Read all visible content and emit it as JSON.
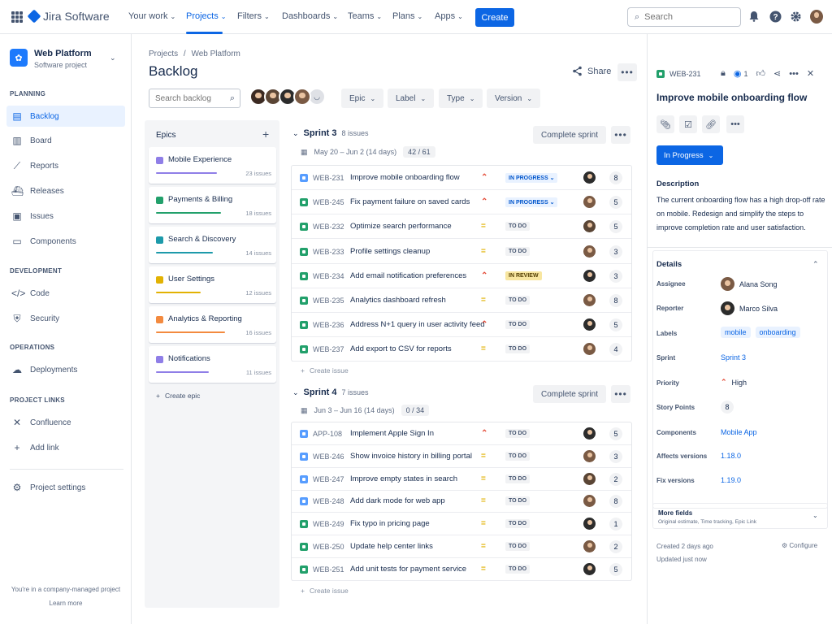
{
  "nav": {
    "product": "Jira Software",
    "items": [
      {
        "label": "Your work"
      },
      {
        "label": "Projects"
      },
      {
        "label": "Filters"
      },
      {
        "label": "Dashboards"
      },
      {
        "label": "Teams"
      },
      {
        "label": "Plans"
      },
      {
        "label": "Apps"
      }
    ],
    "create": "Create",
    "search_placeholder": "Search",
    "accent": "#0c66e4"
  },
  "sidebar": {
    "project_name": "Web Platform",
    "project_type": "Software project",
    "sections": [
      {
        "title": "PLANNING"
      },
      {
        "title": "DEVELOPMENT"
      },
      {
        "title": "OPERATIONS"
      },
      {
        "title": "PROJECT LINKS"
      }
    ],
    "items": [
      {
        "label": "Backlog"
      },
      {
        "label": "Board"
      },
      {
        "label": "Reports"
      },
      {
        "label": "Releases"
      },
      {
        "label": "Issues"
      },
      {
        "label": "Components"
      },
      {
        "label": "Code"
      },
      {
        "label": "Security"
      },
      {
        "label": "Deployments"
      },
      {
        "label": "Confluence"
      },
      {
        "label": "Add link"
      },
      {
        "label": "Project settings"
      }
    ],
    "footer": "You're in a company-managed project",
    "learn_more": "Learn more"
  },
  "main": {
    "breadcrumb_1": "Projects",
    "breadcrumb_sep": "/",
    "breadcrumb_2": "Web Platform",
    "title": "Backlog",
    "share": "Share",
    "search_placeholder": "Search backlog",
    "filters": [
      {
        "label": "Epic"
      },
      {
        "label": "Label"
      },
      {
        "label": "Type"
      },
      {
        "label": "Version"
      }
    ]
  },
  "epics": {
    "title": "Epics",
    "items": [
      {
        "name": "Mobile Experience",
        "count": "23 issues",
        "color": "#8f7ee7",
        "progress": 0.75
      },
      {
        "name": "Payments & Billing",
        "count": "18 issues",
        "color": "#22a06b",
        "progress": 0.8
      },
      {
        "name": "Search & Discovery",
        "count": "14 issues",
        "color": "#1d9aaa",
        "progress": 0.7
      },
      {
        "name": "User Settings",
        "count": "12 issues",
        "color": "#e2b203",
        "progress": 0.55
      },
      {
        "name": "Analytics & Reporting",
        "count": "16 issues",
        "color": "#f38a3f",
        "progress": 0.85
      },
      {
        "name": "Notifications",
        "count": "11 issues",
        "color": "#8f7ee7",
        "progress": 0.65
      }
    ],
    "create": "Create epic"
  },
  "sprints": [
    {
      "name": "Sprint 3",
      "count": "8 issues",
      "dates": "May 20 – Jun 2 (14 days)",
      "progress": "42 / 61",
      "complete": "Complete sprint",
      "create_issue": "Create issue",
      "issues": [
        {
          "type": "task",
          "key": "WEB-231",
          "summary": "Improve mobile onboarding flow",
          "priority": "high",
          "status": "IN PROGRESS",
          "st": "prog",
          "points": "8"
        },
        {
          "type": "story",
          "key": "WEB-245",
          "summary": "Fix payment failure on saved cards",
          "priority": "high",
          "status": "IN PROGRESS",
          "st": "prog",
          "points": "5"
        },
        {
          "type": "story",
          "key": "WEB-232",
          "summary": "Optimize search performance",
          "priority": "med",
          "status": "TO DO",
          "st": "todo",
          "points": "5"
        },
        {
          "type": "story",
          "key": "WEB-233",
          "summary": "Profile settings cleanup",
          "priority": "med",
          "status": "TO DO",
          "st": "todo",
          "points": "3"
        },
        {
          "type": "story",
          "key": "WEB-234",
          "summary": "Add email notification preferences",
          "priority": "high",
          "status": "IN REVIEW",
          "st": "rev",
          "points": "3"
        },
        {
          "type": "story",
          "key": "WEB-235",
          "summary": "Analytics dashboard refresh",
          "priority": "med",
          "status": "TO DO",
          "st": "todo",
          "points": "8"
        },
        {
          "type": "story",
          "key": "WEB-236",
          "summary": "Address N+1 query in user activity feed",
          "priority": "high",
          "status": "TO DO",
          "st": "todo",
          "points": "5"
        },
        {
          "type": "story",
          "key": "WEB-237",
          "summary": "Add export to CSV for reports",
          "priority": "med",
          "status": "TO DO",
          "st": "todo",
          "points": "4"
        }
      ]
    },
    {
      "name": "Sprint 4",
      "count": "7 issues",
      "dates": "Jun 3 – Jun 16 (14 days)",
      "progress": "0 / 34",
      "complete": "Complete sprint",
      "create_issue": "Create issue",
      "issues": [
        {
          "type": "task",
          "key": "APP-108",
          "summary": "Implement Apple Sign In",
          "priority": "high",
          "status": "TO DO",
          "st": "todo",
          "points": "5"
        },
        {
          "type": "task",
          "key": "WEB-246",
          "summary": "Show invoice history in billing portal",
          "priority": "med",
          "status": "TO DO",
          "st": "todo",
          "points": "3"
        },
        {
          "type": "task",
          "key": "WEB-247",
          "summary": "Improve empty states in search",
          "priority": "med",
          "status": "TO DO",
          "st": "todo",
          "points": "2"
        },
        {
          "type": "task",
          "key": "WEB-248",
          "summary": "Add dark mode for web app",
          "priority": "med",
          "status": "TO DO",
          "st": "todo",
          "points": "8"
        },
        {
          "type": "story",
          "key": "WEB-249",
          "summary": "Fix typo in pricing page",
          "priority": "med",
          "status": "TO DO",
          "st": "todo",
          "points": "1"
        },
        {
          "type": "story",
          "key": "WEB-250",
          "summary": "Update help center links",
          "priority": "med",
          "status": "TO DO",
          "st": "todo",
          "points": "2"
        },
        {
          "type": "story",
          "key": "WEB-251",
          "summary": "Add unit tests for payment service",
          "priority": "med",
          "status": "TO DO",
          "st": "todo",
          "points": "5"
        }
      ]
    }
  ],
  "detail": {
    "key": "WEB-231",
    "watchers": "1",
    "title": "Improve mobile onboarding flow",
    "status": "In Progress",
    "desc_heading": "Description",
    "description": "The current onboarding flow has a high drop-off rate on mobile. Redesign and simplify the steps to improve completion rate and user satisfaction.",
    "details_heading": "Details",
    "fields": {
      "assignee_label": "Assignee",
      "assignee": "Alana Song",
      "reporter_label": "Reporter",
      "reporter": "Marco Silva",
      "labels_label": "Labels",
      "label_1": "mobile",
      "label_2": "onboarding",
      "sprint_label": "Sprint",
      "sprint": "Sprint 3",
      "priority_label": "Priority",
      "priority": "High",
      "points_label": "Story Points",
      "points": "8",
      "components_label": "Components",
      "components": "Mobile App",
      "affects_label": "Affects versions",
      "affects": "1.18.0",
      "fix_label": "Fix versions",
      "fix": "1.19.0"
    },
    "more_fields": "More fields",
    "more_fields_sub": "Original estimate, Time tracking, Epic Link",
    "created": "Created 2 days ago",
    "updated": "Updated just now",
    "configure": "Configure"
  }
}
